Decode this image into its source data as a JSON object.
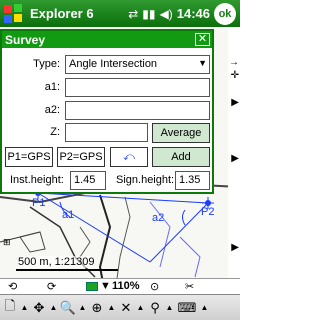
{
  "titlebar": {
    "app_name": "Explorer 6",
    "clock": "14:46",
    "ok_label": "ok"
  },
  "dialog": {
    "title": "Survey",
    "type_label": "Type:",
    "type_value": "Angle Intersection",
    "a1_label": "a1:",
    "a1_value": "",
    "a2_label": "a2:",
    "a2_value": "",
    "z_label": "Z:",
    "z_value": "",
    "average_label": "Average",
    "p1_gps_label": "P1=GPS",
    "p2_gps_label": "P2=GPS",
    "undo_symbol": "⤺",
    "add_label": "Add",
    "inst_height_label": "Inst.height:",
    "inst_height_value": "1.45",
    "sign_height_label": "Sign.height:",
    "sign_height_value": "1.35"
  },
  "map": {
    "p1_label": "P1",
    "p2_label": "P2",
    "a1_label": "a1",
    "a2_label": "a2",
    "scale_label": "500 m, 1:21309"
  },
  "status": {
    "zoom": "110%"
  },
  "colors": {
    "titlebar": "#139a13",
    "markers": "#1a3cff"
  },
  "icons": [
    "windows-logo",
    "sync-icon",
    "signal-icon",
    "volume-icon",
    "new-doc-icon",
    "pan-icon",
    "zoom-icon",
    "gps-icon",
    "satellite-icon",
    "route-icon",
    "keyboard-icon"
  ]
}
